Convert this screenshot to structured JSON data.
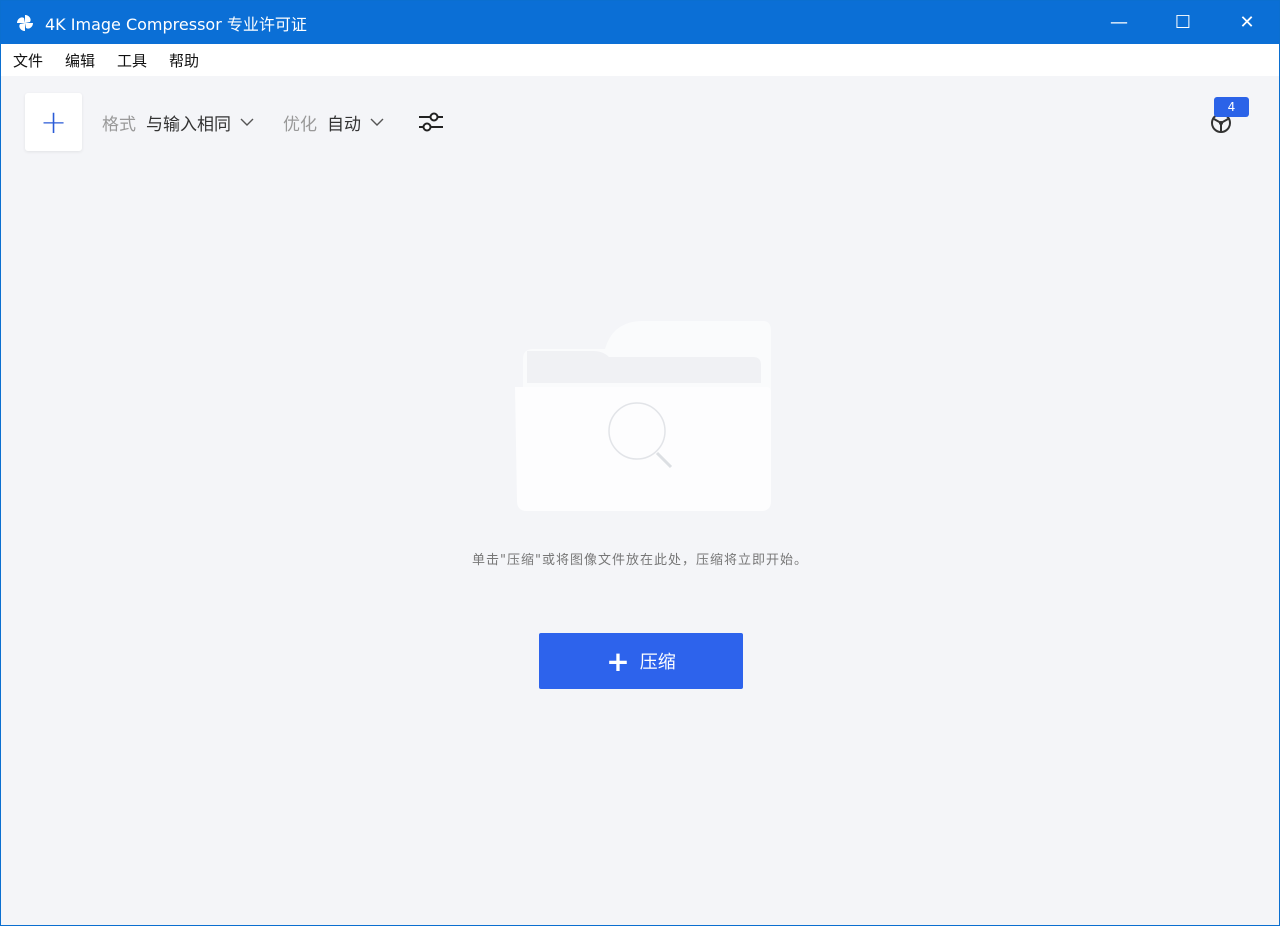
{
  "window": {
    "title": "4K Image Compressor 专业许可证",
    "minimize": "—",
    "maximize": "☐",
    "close": "✕"
  },
  "menu": [
    "文件",
    "编辑",
    "工具",
    "帮助"
  ],
  "toolbar": {
    "add": "+",
    "format_label": "格式",
    "format_value": "与输入相同",
    "optimize_label": "优化",
    "optimize_value": "自动"
  },
  "badge": {
    "count": "4"
  },
  "main": {
    "hint": "单击\"压缩\"或将图像文件放在此处，压缩将立即开始。",
    "compress_plus": "+",
    "compress_label": "压缩"
  },
  "colors": {
    "titlebar": "#0b6fd6",
    "accent": "#2d63ec"
  }
}
